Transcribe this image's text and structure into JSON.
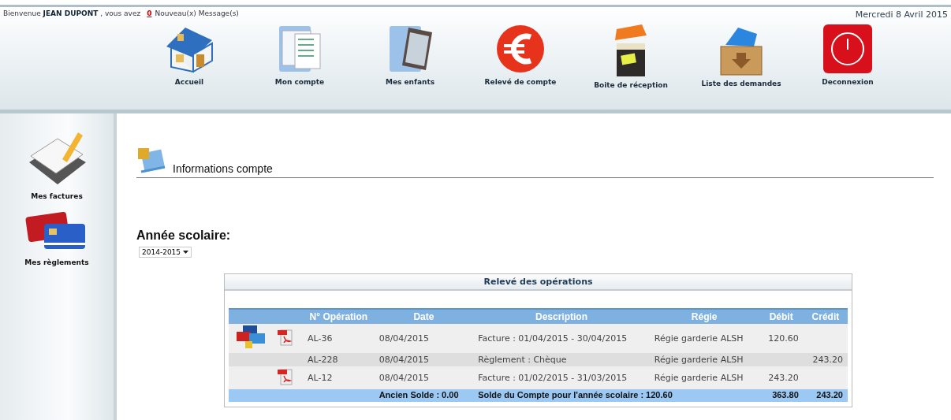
{
  "header": {
    "welcome": "Bienvenue **JEAN DUPONT** , vous avez",
    "message_count": "0",
    "message_label": "Nouveau(x) Message(s)",
    "date": "Mercredi 8 Avril 2015"
  },
  "nav": [
    {
      "label": "Accueil",
      "kind": "house"
    },
    {
      "label": "Mon compte",
      "kind": "documents"
    },
    {
      "label": "Mes enfants",
      "kind": "photo"
    },
    {
      "label": "Relevé de compte",
      "kind": "euro"
    },
    {
      "label": "Boite de réception",
      "kind": "inbox"
    },
    {
      "label": "Liste des demandes",
      "kind": "crate"
    },
    {
      "label": "Deconnexion",
      "kind": "power"
    }
  ],
  "sidebar": {
    "items": [
      {
        "label": "Mes factures",
        "kind": "invoice"
      },
      {
        "label": "Mes règlements",
        "kind": "cards"
      }
    ]
  },
  "page_title": "Informations compte",
  "school_year": {
    "label": "Année scolaire:",
    "value": "2014-2015"
  },
  "table": {
    "title": "Relevé des opérations",
    "columns": [
      "N° Opération",
      "Date",
      "Description",
      "Régie",
      "Débit",
      "Crédit"
    ],
    "rows": [
      {
        "payment_icon": true,
        "pdf_icon": true,
        "cells": [
          "AL-36",
          "08/04/2015",
          "Facture : 01/04/2015 - 30/04/2015",
          "Régie garderie ALSH",
          "120.60",
          ""
        ]
      },
      {
        "payment_icon": false,
        "pdf_icon": false,
        "cells": [
          "AL-228",
          "08/04/2015",
          "Règlement : Chèque",
          "Régie garderie ALSH",
          "",
          "243.20"
        ]
      },
      {
        "payment_icon": false,
        "pdf_icon": true,
        "cells": [
          "AL-12",
          "08/04/2015",
          "Facture : 01/02/2015 - 31/03/2015",
          "Régie garderie ALSH",
          "243.20",
          ""
        ]
      }
    ],
    "footer": {
      "old_balance": "Ancien Solde : 0.00",
      "balance": "Solde du Compte pour l'année scolaire : 120.60",
      "total_debit": "363.80",
      "total_credit": "243.20"
    }
  }
}
